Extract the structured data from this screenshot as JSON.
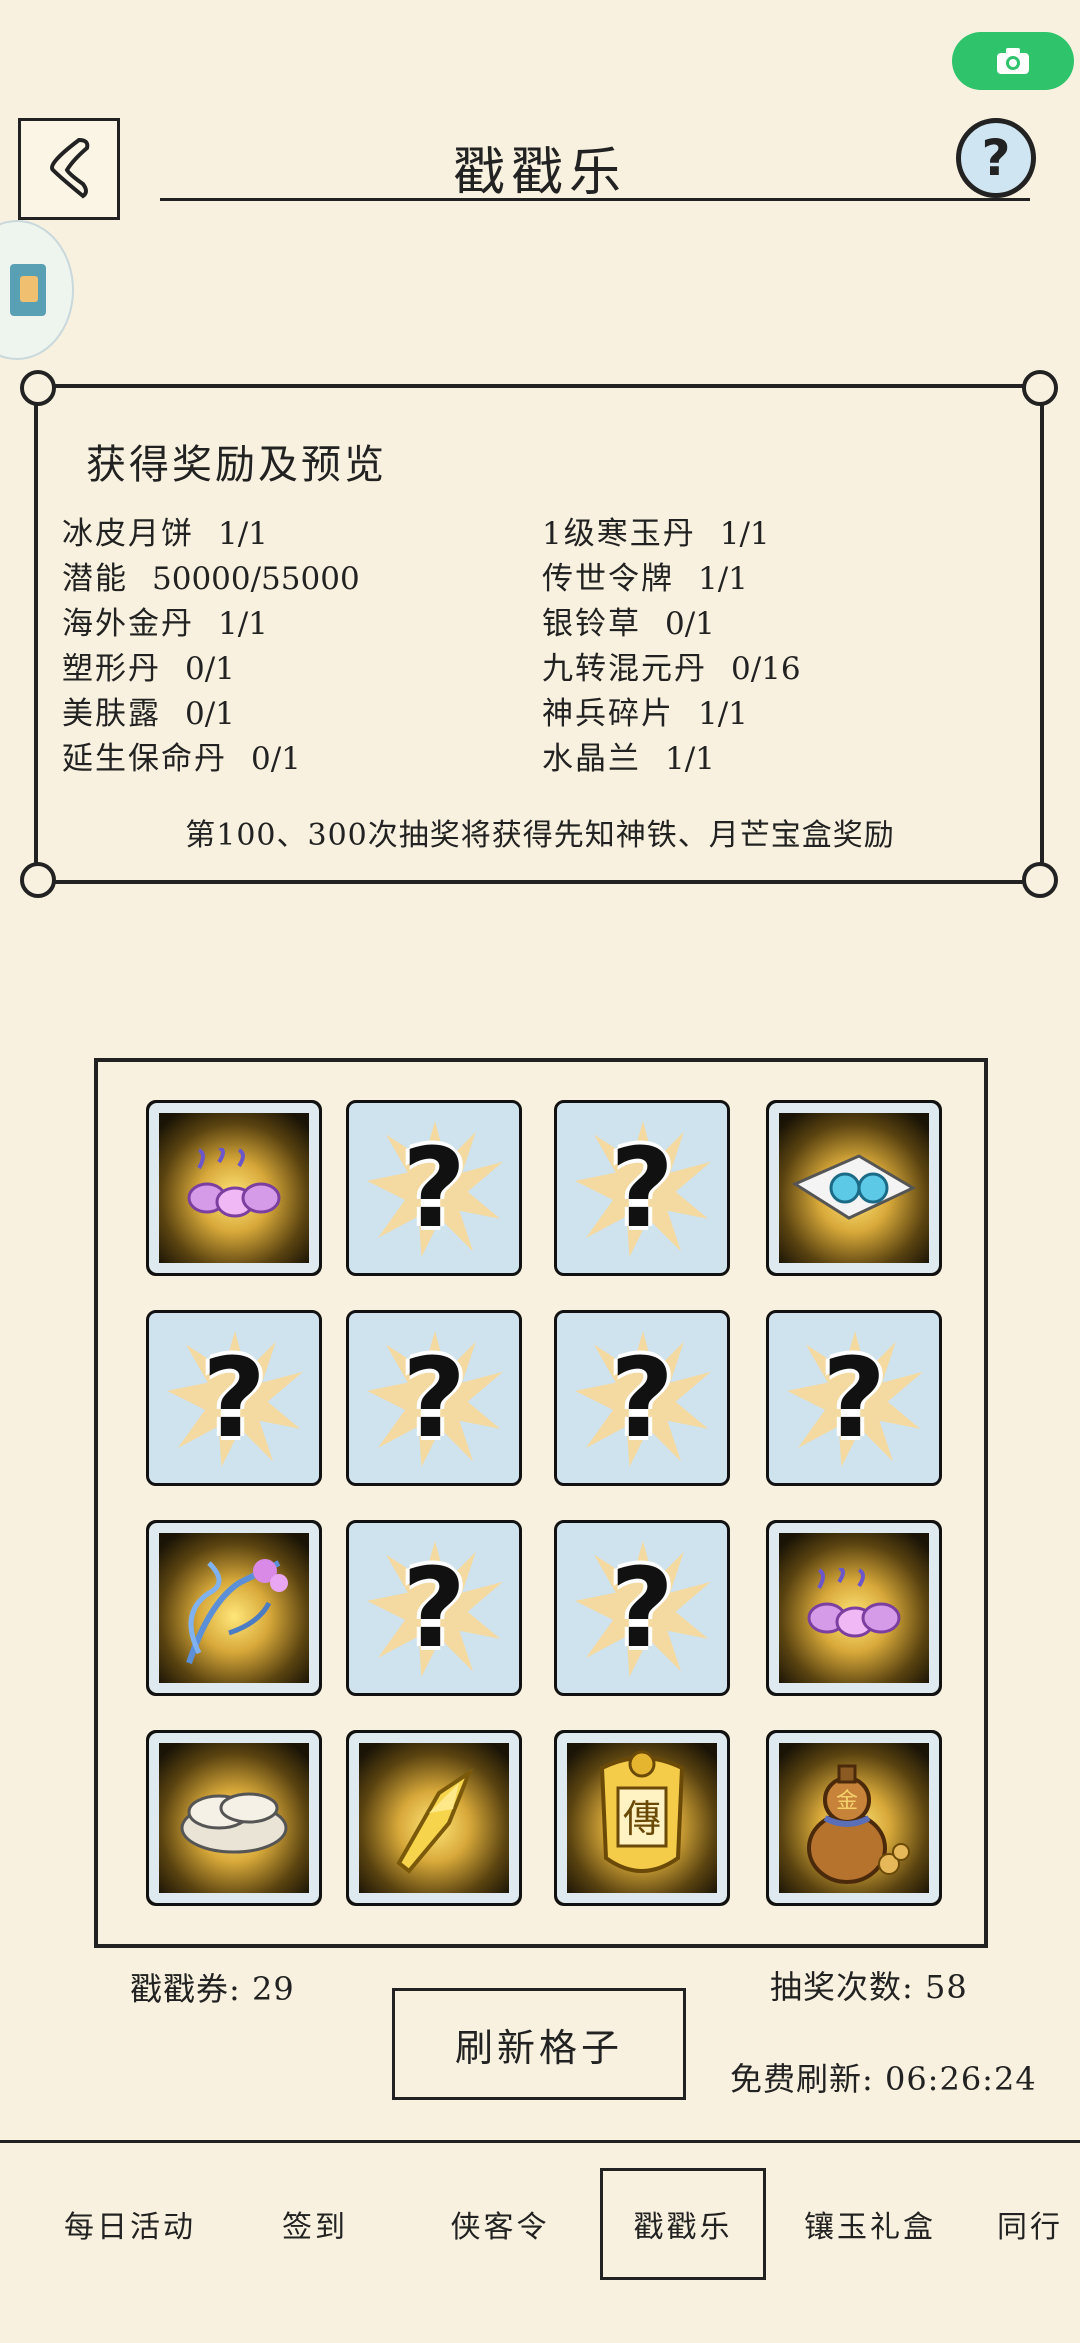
{
  "header": {
    "title": "戳戳乐"
  },
  "rewards": {
    "heading": "获得奖励及预览",
    "left": [
      {
        "name": "冰皮月饼",
        "count": "1/1"
      },
      {
        "name": "潜能",
        "count": "50000/55000"
      },
      {
        "name": "海外金丹",
        "count": "1/1"
      },
      {
        "name": "塑形丹",
        "count": "0/1"
      },
      {
        "name": "美肤露",
        "count": "0/1"
      },
      {
        "name": "延生保命丹",
        "count": "0/1"
      }
    ],
    "right": [
      {
        "name": "1级寒玉丹",
        "count": "1/1"
      },
      {
        "name": "传世令牌",
        "count": "1/1"
      },
      {
        "name": "银铃草",
        "count": "0/1"
      },
      {
        "name": "九转混元丹",
        "count": "0/16"
      },
      {
        "name": "神兵碎片",
        "count": "1/1"
      },
      {
        "name": "水晶兰",
        "count": "1/1"
      }
    ],
    "note": "第100、300次抽奖将获得先知神铁、月芒宝盒奖励"
  },
  "grid": {
    "cells": [
      {
        "state": "open",
        "icon": "purple-pills-icon"
      },
      {
        "state": "hidden",
        "icon": "question-mark-icon"
      },
      {
        "state": "hidden",
        "icon": "question-mark-icon"
      },
      {
        "state": "open",
        "icon": "blue-beads-icon"
      },
      {
        "state": "hidden",
        "icon": "question-mark-icon"
      },
      {
        "state": "hidden",
        "icon": "question-mark-icon"
      },
      {
        "state": "hidden",
        "icon": "question-mark-icon"
      },
      {
        "state": "hidden",
        "icon": "question-mark-icon"
      },
      {
        "state": "open",
        "icon": "crystal-orchid-icon"
      },
      {
        "state": "hidden",
        "icon": "question-mark-icon"
      },
      {
        "state": "hidden",
        "icon": "question-mark-icon"
      },
      {
        "state": "open",
        "icon": "purple-pills-icon"
      },
      {
        "state": "open",
        "icon": "mooncake-icon"
      },
      {
        "state": "open",
        "icon": "weapon-shard-icon"
      },
      {
        "state": "open",
        "icon": "heirloom-token-icon"
      },
      {
        "state": "open",
        "icon": "gourd-icon"
      }
    ],
    "mystery_glyph": "?",
    "token_glyph": "傳",
    "gourd_glyph": "金"
  },
  "footer": {
    "tickets": "戳戳券: 29",
    "draws": "抽奖次数: 58",
    "refresh_label": "刷新格子",
    "free_refresh": "免费刷新: 06:26:24"
  },
  "tabs": [
    "每日活动",
    "签到",
    "侠客令",
    "戳戳乐",
    "镶玉礼盒",
    "同行"
  ],
  "colors": {
    "background": "#f8f1df",
    "camera": "#2fc46b",
    "tile": "#cfe3ee"
  }
}
